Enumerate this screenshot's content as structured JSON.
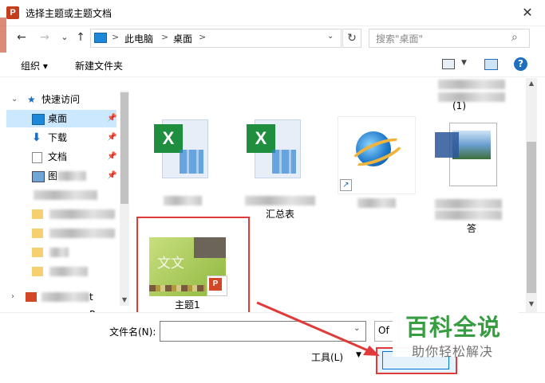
{
  "window": {
    "title": "选择主题或主题文档",
    "app_icon": "powerpoint-icon",
    "close_glyph": "✕"
  },
  "address_bar": {
    "back": "←",
    "forward": "→",
    "recent": "⌄",
    "up": "↑",
    "crumbs": [
      "此电脑",
      "桌面"
    ],
    "separator": ">",
    "dropdown": "⌄",
    "refresh": "↻",
    "search_placeholder": "搜索\"桌面\""
  },
  "toolbar": {
    "organize": "组织 ▾",
    "new_folder": "新建文件夹",
    "help": "?"
  },
  "nav": {
    "quick_access": "快速访问",
    "items": [
      {
        "label": "桌面",
        "icon": "desktop-icon",
        "selected": true
      },
      {
        "label": "下载",
        "icon": "download-icon"
      },
      {
        "label": "文档",
        "icon": "document-icon"
      },
      {
        "label": "图",
        "icon": "picture-icon"
      }
    ],
    "bottom_item_suffix": "t Power"
  },
  "files": {
    "captions": [
      "(1)",
      "汇总表",
      "答"
    ],
    "selected_item": {
      "label": "主题1",
      "thumb_text": "文文"
    }
  },
  "bottom": {
    "filename_label": "文件名(N):",
    "filename_value": "",
    "filter_text": "Of",
    "tools": "工具(L)",
    "tools_caret": "▼"
  },
  "watermark": {
    "title": "百科全说",
    "subtitle": "助你轻松解决"
  },
  "colors": {
    "highlight_red": "#e03a3a",
    "accent_blue": "#1e6fc0",
    "watermark_green": "#2f9a3a"
  }
}
